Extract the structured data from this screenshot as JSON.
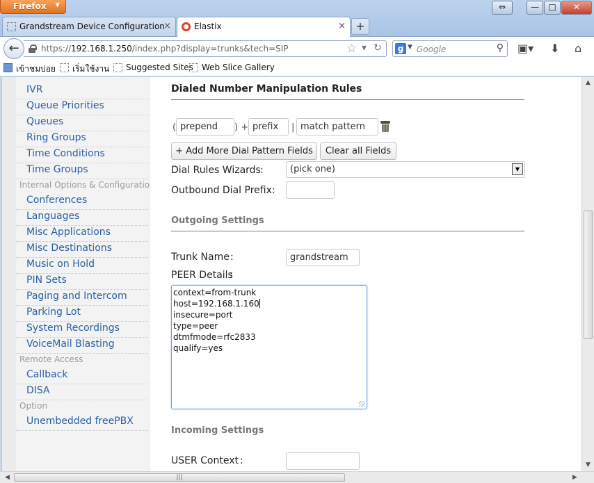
{
  "browser": {
    "app_button": "Firefox",
    "window_controls": {
      "restore": "⇔",
      "minimize": "—",
      "maximize": "□",
      "close": "✕"
    },
    "tabs": [
      {
        "label": "Grandstream Device Configuration",
        "close": "×"
      },
      {
        "label": "Elastix",
        "close": "×"
      }
    ],
    "new_tab": "+",
    "url": {
      "prefix": "https://",
      "host": "192.168.1.250",
      "path": "/index.php?display=trunks&tech=SIP"
    },
    "search": {
      "engine": "g",
      "placeholder": "Google"
    },
    "bookmarks": [
      "เข้าชมบ่อย",
      "เริ่มใช้งาน",
      "Suggested Sites",
      "Web Slice Gallery"
    ]
  },
  "sidebar": {
    "items_top": [
      "IVR",
      "Queue Priorities",
      "Queues",
      "Ring Groups",
      "Time Conditions",
      "Time Groups"
    ],
    "cat_internal": "Internal Options & Configuration",
    "items_internal": [
      "Conferences",
      "Languages",
      "Misc Applications",
      "Misc Destinations",
      "Music on Hold",
      "PIN Sets",
      "Paging and Intercom",
      "Parking Lot",
      "System Recordings",
      "VoiceMail Blasting"
    ],
    "cat_remote": "Remote Access",
    "items_remote": [
      "Callback",
      "DISA"
    ],
    "cat_option": "Option",
    "items_option": [
      "Unembedded freePBX"
    ]
  },
  "form": {
    "dial_rules_heading": "Dialed Number Manipulation Rules",
    "pattern": {
      "prepend": "prepend",
      "prefix": "prefix",
      "match": "match pattern",
      "open_paren": "(",
      "close_plus": ") +",
      "pipe": "|"
    },
    "add_more_label": "+ Add More Dial Pattern Fields",
    "clear_all_label": "Clear all Fields",
    "dial_rules_wizards_label": "Dial Rules Wizards",
    "dial_rules_wizards_value": "(pick one)",
    "outbound_prefix_label": "Outbound Dial Prefix",
    "outbound_prefix_value": "",
    "outgoing_heading": "Outgoing Settings",
    "trunk_name_label": "Trunk Name",
    "trunk_name_value": "grandstream",
    "peer_details_label": "PEER Details",
    "peer_details_lines": [
      "context=from-trunk",
      "host=192.168.1.160",
      "insecure=port",
      "type=peer",
      "dtmfmode=rfc2833",
      "qualify=yes"
    ],
    "incoming_heading": "Incoming Settings",
    "user_context_label": "USER Context",
    "user_context_value": ""
  }
}
